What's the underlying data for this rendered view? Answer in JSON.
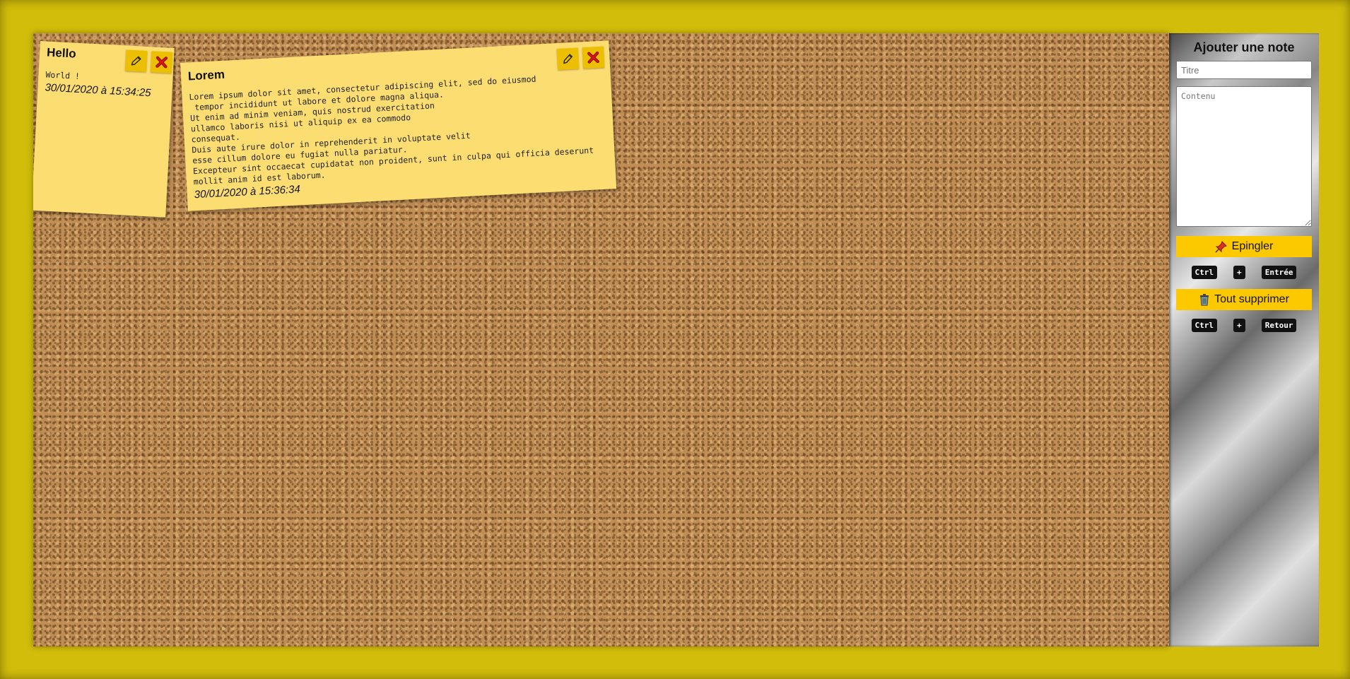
{
  "notes": [
    {
      "title": "Hello",
      "content": "World !",
      "date": "30/01/2020 à 15:34:25",
      "edit_icon": "pencil-icon",
      "delete_icon": "close-icon"
    },
    {
      "title": "Lorem",
      "content": "Lorem ipsum dolor sit amet, consectetur adipiscing elit, sed do eiusmod\n tempor incididunt ut labore et dolore magna aliqua.\nUt enim ad minim veniam, quis nostrud exercitation\nullamco laboris nisi ut aliquip ex ea commodo\nconsequat.\nDuis aute irure dolor in reprehenderit in voluptate velit\nesse cillum dolore eu fugiat nulla pariatur.\nExcepteur sint occaecat cupidatat non proident, sunt in culpa qui officia deserunt\nmollit anim id est laborum.",
      "date": "30/01/2020 à 15:36:34",
      "edit_icon": "pencil-icon",
      "delete_icon": "close-icon"
    }
  ],
  "sidebar": {
    "heading": "Ajouter une note",
    "title_placeholder": "Titre",
    "content_placeholder": "Contenu",
    "pin_label": "Epingler",
    "pin_icon": "pushpin-icon",
    "pin_shortcut": {
      "key1": "Ctrl",
      "plus": "+",
      "key2": "Entrée"
    },
    "delete_all_label": "Tout supprimer",
    "delete_all_icon": "trash-icon",
    "delete_shortcut": {
      "key1": "Ctrl",
      "plus": "+",
      "key2": "Retour"
    }
  },
  "colors": {
    "frame": "#d1bd0a",
    "note": "#fcdd72",
    "button": "#fcc800",
    "icon_button": "#ecc000"
  }
}
